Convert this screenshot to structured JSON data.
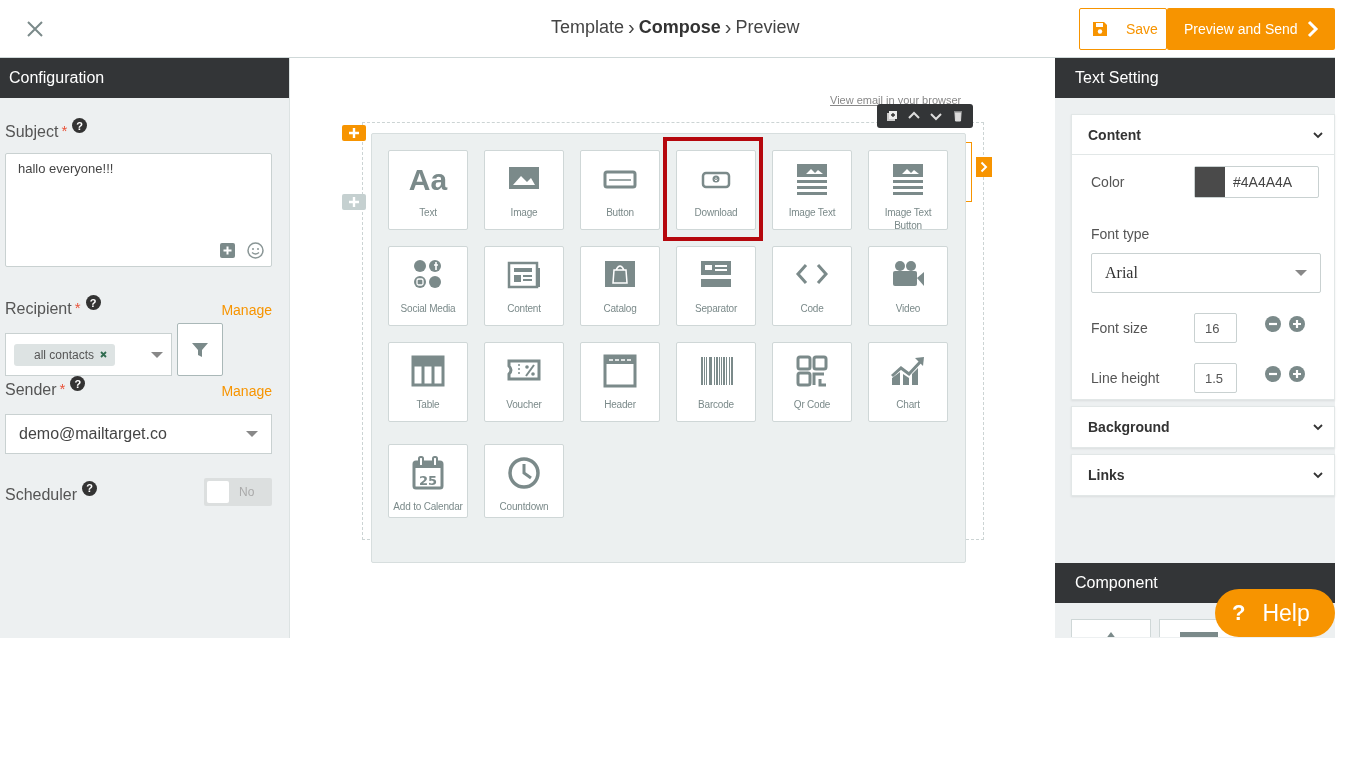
{
  "header": {
    "breadcrumb": [
      {
        "label": "Template",
        "selected": false
      },
      {
        "label": "Compose",
        "selected": true
      },
      {
        "label": "Preview",
        "selected": false
      }
    ],
    "separator": "›",
    "save": "Save",
    "send": "Preview and Send"
  },
  "configuration": {
    "title": "Configuration",
    "hint_mark": "?",
    "required_mark": "*",
    "subject": {
      "label": "Subject",
      "required": true,
      "value": "hallo everyone!!!"
    },
    "recipient": {
      "label": "Recipient",
      "required": true,
      "manage": "Manage",
      "tags": [
        "all contacts"
      ]
    },
    "sender": {
      "label": "Sender",
      "required": true,
      "manage": "Manage",
      "value": "demo@mailtarget.co"
    },
    "scheduler": {
      "label": "Scheduler",
      "on": false,
      "state_text": "No"
    }
  },
  "canvas": {
    "browser_link": "View email in your browser"
  },
  "palette": {
    "tiles": [
      {
        "label": "Text",
        "highlighted": false,
        "glyph": "Aa"
      },
      {
        "label": "Image",
        "highlighted": false
      },
      {
        "label": "Button",
        "highlighted": false
      },
      {
        "label": "Download",
        "highlighted": true
      },
      {
        "label": "Image Text",
        "highlighted": false
      },
      {
        "label": "Image Text Button",
        "highlighted": false
      },
      {
        "label": "Social Media",
        "highlighted": false
      },
      {
        "label": "Content",
        "highlighted": false
      },
      {
        "label": "Catalog",
        "highlighted": false
      },
      {
        "label": "Separator",
        "highlighted": false
      },
      {
        "label": "Code",
        "highlighted": false
      },
      {
        "label": "Video",
        "highlighted": false
      },
      {
        "label": "Table",
        "highlighted": false
      },
      {
        "label": "Voucher",
        "highlighted": false
      },
      {
        "label": "Header",
        "highlighted": false
      },
      {
        "label": "Barcode",
        "highlighted": false
      },
      {
        "label": "Qr Code",
        "highlighted": false
      },
      {
        "label": "Chart",
        "highlighted": false
      },
      {
        "label": "Add to Calendar",
        "highlighted": false,
        "glyph": "25"
      },
      {
        "label": "Countdown",
        "highlighted": false
      }
    ]
  },
  "text_setting": {
    "title": "Text Setting",
    "sections": [
      {
        "title": "Content",
        "expanded": true,
        "color": {
          "label": "Color",
          "value": "#4A4A4A"
        },
        "font_type": {
          "label": "Font type",
          "value": "Arial"
        },
        "steppers": [
          {
            "label": "Font size",
            "value": "16"
          },
          {
            "label": "Line height",
            "value": "1.5"
          }
        ]
      },
      {
        "title": "Background",
        "expanded": false
      },
      {
        "title": "Links",
        "expanded": false
      }
    ]
  },
  "component": {
    "title": "Component"
  },
  "help": {
    "icon": "?",
    "label": "Help"
  }
}
